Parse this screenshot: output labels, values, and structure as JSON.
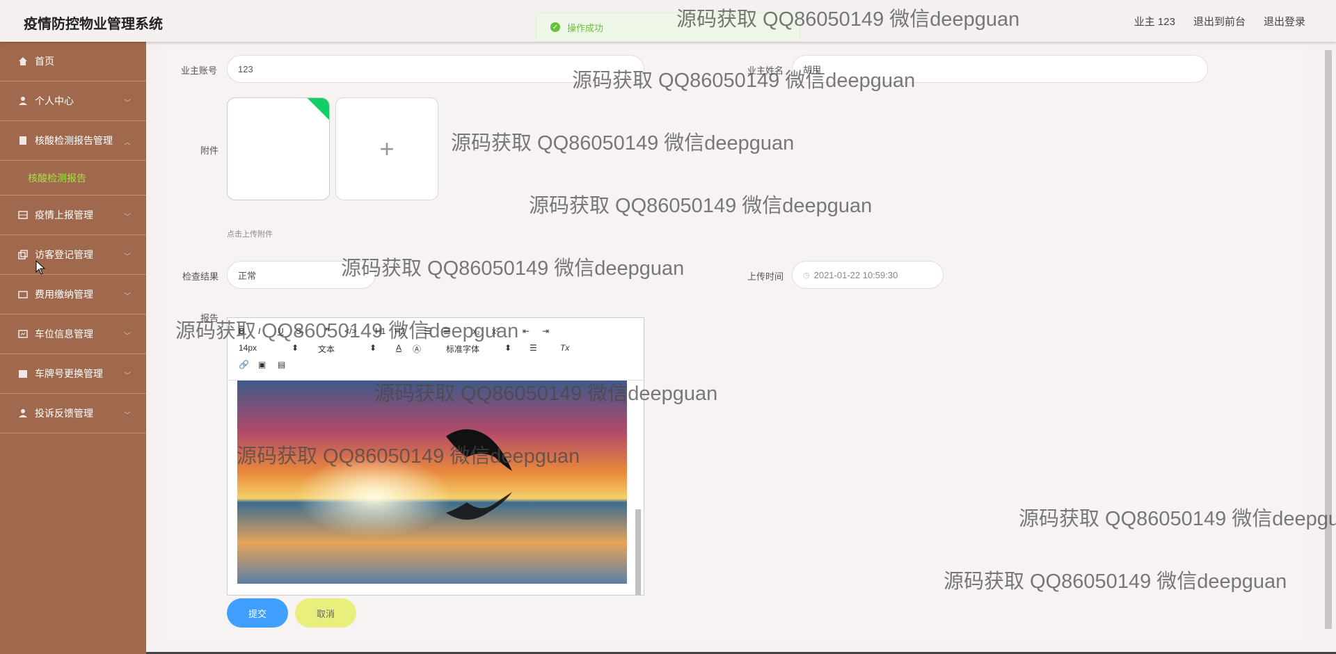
{
  "app": {
    "title": "疫情防控物业管理系统"
  },
  "header": {
    "user": "业主 123",
    "front_link": "退出到前台",
    "logout": "退出登录"
  },
  "toast": {
    "message": "操作成功"
  },
  "sidebar": {
    "items": [
      {
        "label": "首页",
        "icon": "home-icon"
      },
      {
        "label": "个人中心",
        "icon": "user-icon"
      },
      {
        "label": "核酸检测报告管理",
        "icon": "document-icon",
        "expanded": true
      },
      {
        "label": "疫情上报管理",
        "icon": "grid-icon"
      },
      {
        "label": "访客登记管理",
        "icon": "copy-icon"
      },
      {
        "label": "费用缴纳管理",
        "icon": "wallet-icon"
      },
      {
        "label": "车位信息管理",
        "icon": "board-icon"
      },
      {
        "label": "车牌号更换管理",
        "icon": "calendar-icon"
      },
      {
        "label": "投诉反馈管理",
        "icon": "user-icon"
      }
    ],
    "subitem": "核酸检测报告",
    "active_color": "#a8e04a",
    "bg_color": "#a0694d"
  },
  "form": {
    "account_label": "业主账号",
    "account_value": "123",
    "name_label": "业主姓名",
    "name_value": "胡用",
    "attachment_label": "附件",
    "attachment_hint": "点击上传附件",
    "result_label": "检查结果",
    "result_value": "正常",
    "upload_time_label": "上传时间",
    "upload_time_value": "2021-01-22 10:59:30",
    "report_label": "报告"
  },
  "editor": {
    "font_size": "14px",
    "paragraph": "文本",
    "font_family": "标准字体",
    "tool_h1": "H1",
    "tool_h2": "H2",
    "tool_bold": "B",
    "tool_italic": "I",
    "tool_underline": "U",
    "tool_clear": "Tx"
  },
  "buttons": {
    "submit": "提交",
    "cancel": "取消"
  },
  "watermark": "源码获取 QQ86050149 微信deepguan"
}
